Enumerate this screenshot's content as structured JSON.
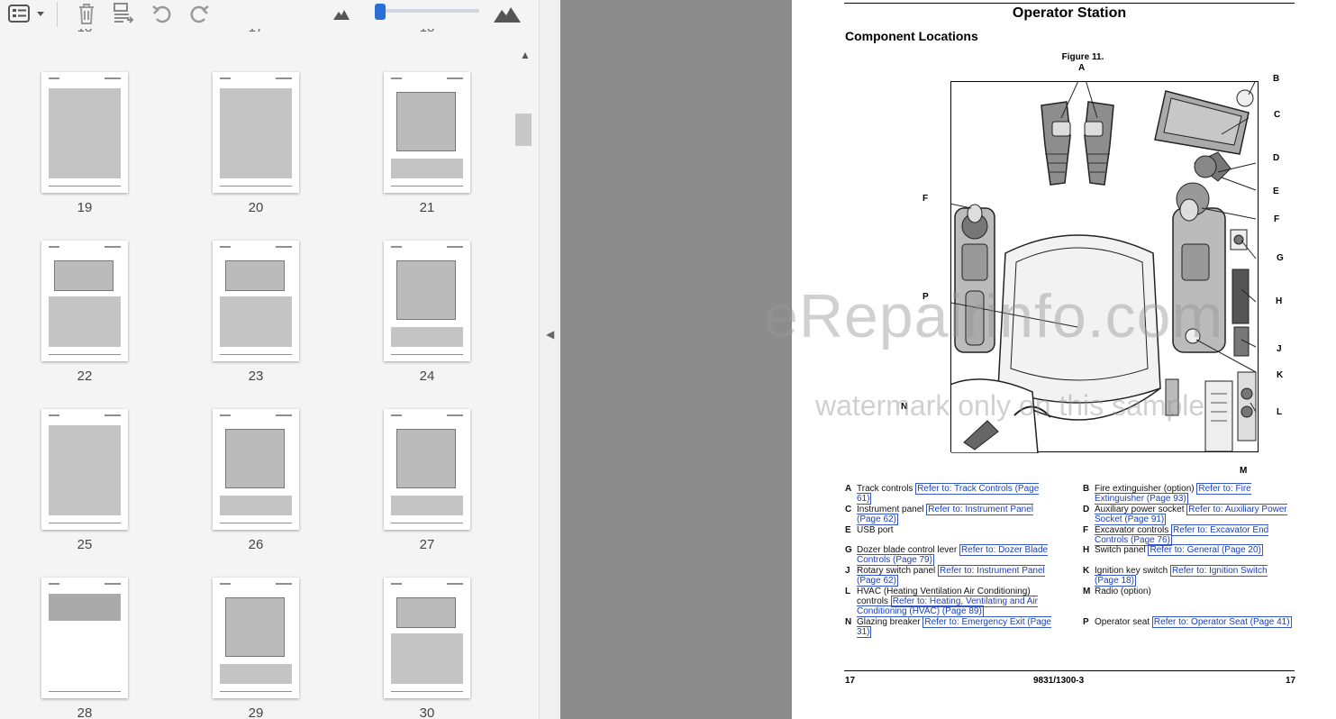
{
  "toolbar": {
    "icons": [
      "thumbnail-options-icon",
      "delete-icon",
      "extract-pages-icon",
      "undo-icon",
      "redo-icon",
      "zoom-out-mountain-icon",
      "zoom-in-mountain-icon"
    ],
    "zoom_slider_fraction": 0.05
  },
  "thumbnails": {
    "partial_top_labels": [
      "18",
      "17",
      "18"
    ],
    "pages": [
      {
        "label": "19",
        "kind": "text"
      },
      {
        "label": "20",
        "kind": "text"
      },
      {
        "label": "21",
        "kind": "figure"
      },
      {
        "label": "22",
        "kind": "mixed"
      },
      {
        "label": "23",
        "kind": "mixed"
      },
      {
        "label": "24",
        "kind": "figure"
      },
      {
        "label": "25",
        "kind": "text"
      },
      {
        "label": "26",
        "kind": "figure"
      },
      {
        "label": "27",
        "kind": "figure"
      },
      {
        "label": "28",
        "kind": "table"
      },
      {
        "label": "29",
        "kind": "figure"
      },
      {
        "label": "30",
        "kind": "mixed"
      }
    ]
  },
  "document": {
    "title": "Operator Station",
    "section": "Component Locations",
    "figure_title": "Figure 11.",
    "callouts": [
      "A",
      "B",
      "C",
      "D",
      "E",
      "F",
      "F",
      "G",
      "H",
      "J",
      "K",
      "L",
      "M",
      "N",
      "P"
    ],
    "legend_left": [
      {
        "key": "A",
        "text": "Track controls ",
        "link": "Refer to: Track Controls (Page 61)"
      },
      {
        "key": "C",
        "text": "Instrument panel ",
        "link": "Refer to: Instrument Panel (Page 62)"
      },
      {
        "key": "E",
        "text": "USB port",
        "link": ""
      },
      {
        "key": "G",
        "text": "Dozer blade control lever ",
        "link": "Refer to: Dozer Blade Controls (Page 79)"
      },
      {
        "key": "J",
        "text": "Rotary switch panel ",
        "link": "Refer to: Instrument Panel (Page 62)"
      },
      {
        "key": "L",
        "text": "HVAC (Heating Ventilation Air Conditioning) controls ",
        "link": "Refer to: Heating, Ventilating and Air Conditioning (HVAC) (Page 89)"
      },
      {
        "key": "N",
        "text": "Glazing breaker ",
        "link": "Refer to: Emergency Exit (Page 31)"
      }
    ],
    "legend_right": [
      {
        "key": "B",
        "text": "Fire extinguisher (option) ",
        "link": "Refer to: Fire Extinguisher (Page 93)"
      },
      {
        "key": "D",
        "text": "Auxiliary power socket ",
        "link": "Refer to: Auxiliary Power Socket (Page 91)"
      },
      {
        "key": "F",
        "text": "Excavator controls ",
        "link": "Refer to: Excavator End Controls (Page 76)"
      },
      {
        "key": "H",
        "text": "Switch panel ",
        "link": "Refer to: General (Page 20)"
      },
      {
        "key": "K",
        "text": "Ignition key switch ",
        "link": "Refer to: Ignition Switch (Page 18)"
      },
      {
        "key": "M",
        "text": "Radio (option)",
        "link": ""
      },
      {
        "key": "P",
        "text": "Operator seat ",
        "link": "Refer to: Operator Seat (Page 41)"
      }
    ],
    "footer_left": "17",
    "footer_center": "9831/1300-3",
    "footer_right": "17"
  },
  "watermark": {
    "line1": "eRepairinfo.com",
    "line2": "watermark only on this sample"
  }
}
